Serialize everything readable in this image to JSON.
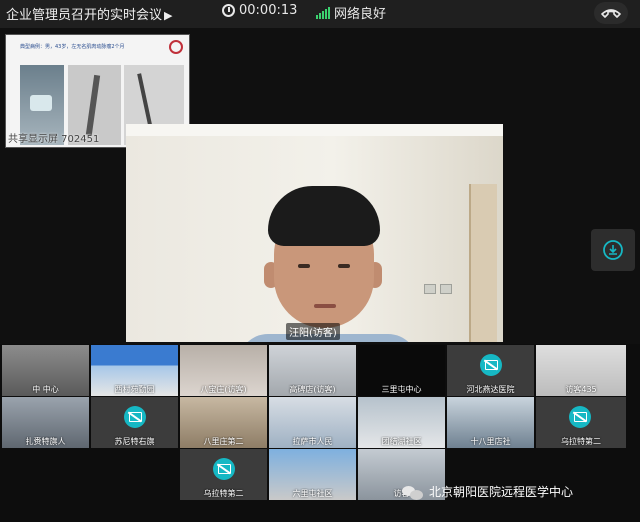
{
  "topbar": {
    "meeting_title": "企业管理员召开的实时会议",
    "title_arrow": "▶",
    "timer": "00:00:13",
    "network_status": "网络良好"
  },
  "shared_screen": {
    "slide_header": "典型病例：男，43岁，左无名肌肉动脉瘤2个月",
    "caption": "共享显示屏 702451"
  },
  "main_speaker": {
    "label": "汪阳(访客)"
  },
  "participants": [
    {
      "label": "中 中心",
      "camera_off": false
    },
    {
      "label": "西村苑勤园",
      "camera_off": false
    },
    {
      "label": "八宝庄(访客)",
      "camera_off": false
    },
    {
      "label": "高碑店(访客)",
      "camera_off": false
    },
    {
      "label": "三里屯中心",
      "camera_off": false
    },
    {
      "label": "河北燕达医院",
      "camera_off": true
    },
    {
      "label": "访客435",
      "camera_off": false
    },
    {
      "label": "扎赉特旗人",
      "camera_off": false
    },
    {
      "label": "苏尼特右旗",
      "camera_off": true
    },
    {
      "label": "八里庄第二",
      "camera_off": false
    },
    {
      "label": "拉萨市人民",
      "camera_off": false
    },
    {
      "label": "团结湖社区",
      "camera_off": false
    },
    {
      "label": "十八里店社",
      "camera_off": false
    },
    {
      "label": "乌拉特第二",
      "camera_off": true
    },
    {
      "label": "乌拉特第二",
      "camera_off": true
    },
    {
      "label": "六里屯社区",
      "camera_off": false
    },
    {
      "label": "访客",
      "camera_off": false
    }
  ],
  "footer": {
    "watermark": "北京朝阳医院远程医学中心"
  },
  "colors": {
    "accent_teal": "#16b8c4",
    "signal_green": "#3bd16f"
  }
}
